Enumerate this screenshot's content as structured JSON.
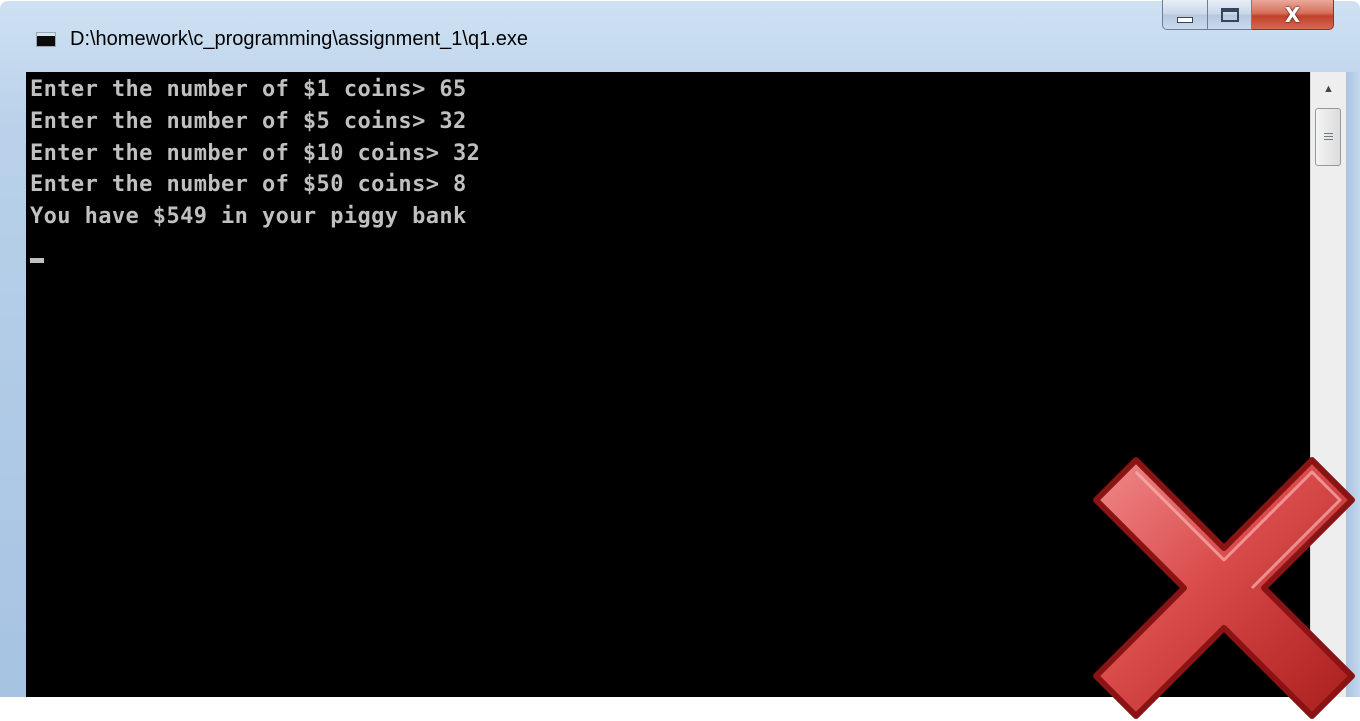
{
  "window": {
    "title": "D:\\homework\\c_programming\\assignment_1\\q1.exe",
    "icon": "console-app-icon",
    "buttons": {
      "minimize_icon": "minimize-icon",
      "maximize_icon": "maximize-icon",
      "close_label": "X"
    }
  },
  "console": {
    "lines": [
      "Enter the number of $1 coins> 65",
      "Enter the number of $5 coins> 32",
      "Enter the number of $10 coins> 32",
      "Enter the number of $50 coins> 8",
      "You have $549 in your piggy bank"
    ],
    "text_color": "#c0c0c0",
    "background_color": "#000000"
  },
  "overlay": {
    "icon": "red-x-icon",
    "color": "#d32f2f"
  }
}
